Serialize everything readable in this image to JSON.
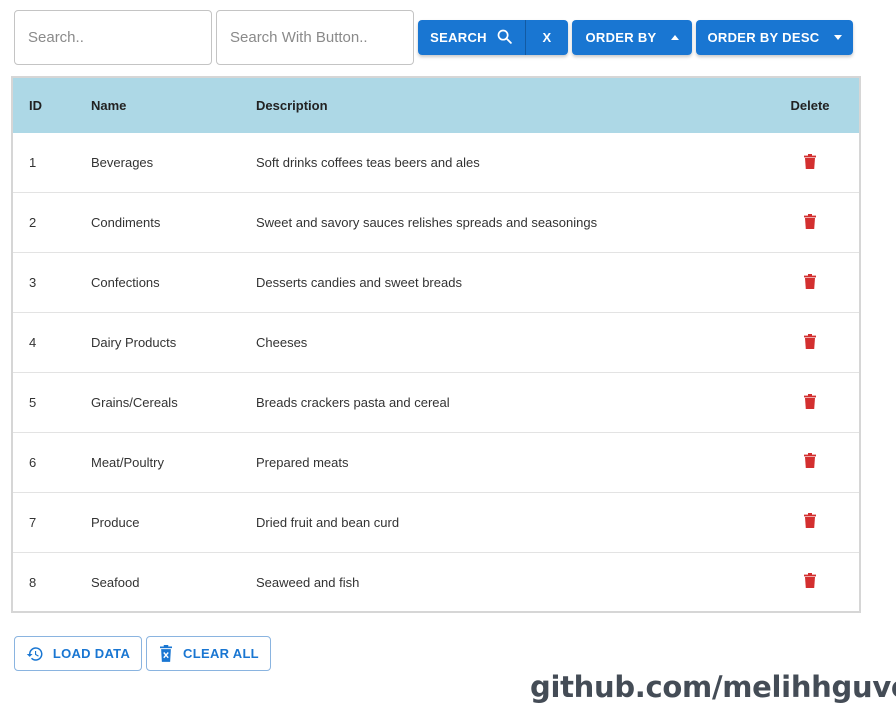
{
  "toolbar": {
    "search_placeholder": "Search..",
    "search_with_button_placeholder": "Search With Button..",
    "search_label": "SEARCH",
    "clear_label": "X",
    "order_by_label": "ORDER BY",
    "order_by_desc_label": "ORDER BY DESC",
    "accent_color": "#1976d2"
  },
  "table": {
    "header_color": "#add8e6",
    "columns": [
      "ID",
      "Name",
      "Description",
      "Delete"
    ],
    "rows": [
      {
        "id": "1",
        "name": "Beverages",
        "description": "Soft drinks coffees teas beers and ales"
      },
      {
        "id": "2",
        "name": "Condiments",
        "description": "Sweet and savory sauces relishes spreads and seasonings"
      },
      {
        "id": "3",
        "name": "Confections",
        "description": "Desserts candies and sweet breads"
      },
      {
        "id": "4",
        "name": "Dairy Products",
        "description": "Cheeses"
      },
      {
        "id": "5",
        "name": "Grains/Cereals",
        "description": "Breads crackers pasta and cereal"
      },
      {
        "id": "6",
        "name": "Meat/Poultry",
        "description": "Prepared meats"
      },
      {
        "id": "7",
        "name": "Produce",
        "description": "Dried fruit and bean curd"
      },
      {
        "id": "8",
        "name": "Seafood",
        "description": "Seaweed and fish"
      }
    ],
    "delete_icon": "trash-icon",
    "delete_color": "#d32f2f"
  },
  "footer": {
    "load_label": "LOAD DATA",
    "load_icon": "history-icon",
    "clear_all_label": "CLEAR ALL",
    "clear_all_icon": "delete-sweep-icon",
    "watermark": "github.com/melihhguven"
  }
}
